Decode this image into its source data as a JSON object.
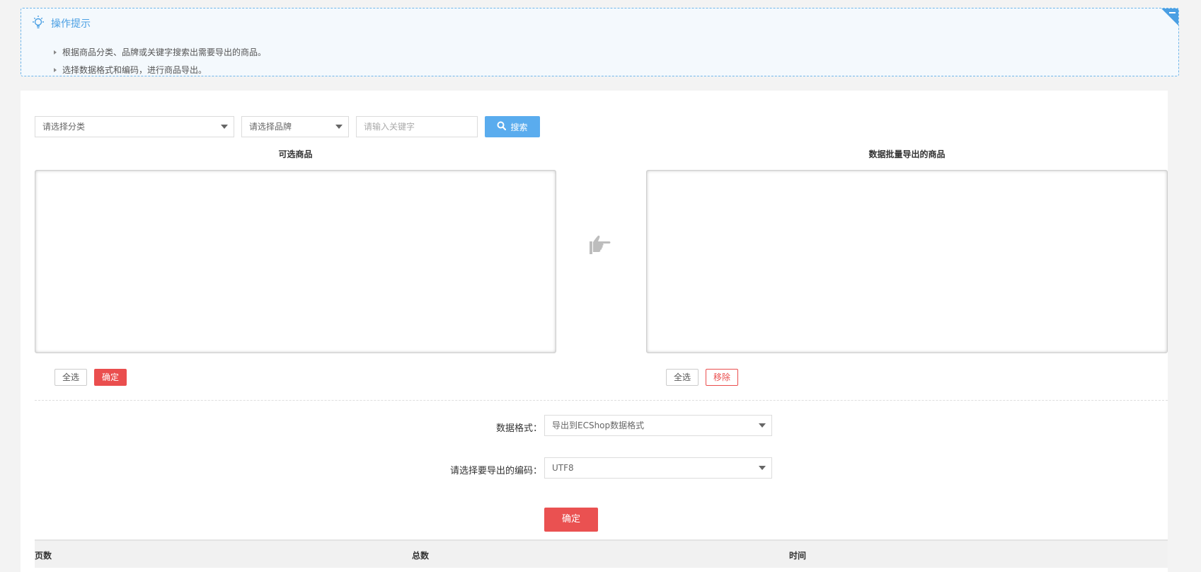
{
  "tips": {
    "title": "操作提示",
    "items": [
      "根据商品分类、品牌或关键字搜索出需要导出的商品。",
      "选择数据格式和编码，进行商品导出。"
    ],
    "icons": [
      "lightbulb-icon",
      "collapse-icon"
    ]
  },
  "search": {
    "category_placeholder": "请选择分类",
    "brand_placeholder": "请选择品牌",
    "keyword_placeholder": "请输入关键字",
    "button_label": "搜索",
    "button_icon": "search-icon"
  },
  "available": {
    "title": "可选商品",
    "select_all_label": "全选",
    "confirm_label": "确定"
  },
  "transfer_icon": "pointing-hand-icon",
  "export_list": {
    "title": "数据批量导出的商品",
    "select_all_label": "全选",
    "remove_label": "移除"
  },
  "form": {
    "format_label": "数据格式：",
    "format_value": "导出到ECShop数据格式",
    "encoding_label": "请选择要导出的编码：",
    "encoding_value": "UTF8",
    "submit_label": "确定"
  },
  "table": {
    "columns": [
      "页数",
      "总数",
      "时间"
    ]
  },
  "colors": {
    "accent_blue": "#5aacee",
    "danger_red": "#ea4e4e"
  }
}
